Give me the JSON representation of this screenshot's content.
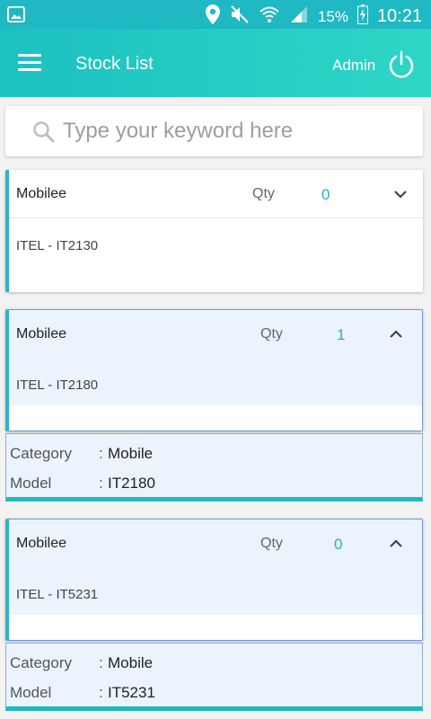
{
  "status_bar": {
    "battery": "15%",
    "time": "10:21",
    "icons": [
      "image-icon",
      "location-icon",
      "mute-icon",
      "wifi-icon",
      "signal-icon",
      "battery-charging-icon"
    ]
  },
  "app_bar": {
    "title": "Stock List",
    "user": "Admin"
  },
  "search": {
    "placeholder": "Type your keyword here"
  },
  "labels": {
    "qty": "Qty",
    "category": "Category",
    "model": "Model",
    "separator": ":"
  },
  "items": [
    {
      "brand": "Mobilee",
      "qty": "0",
      "name": "ITEL - IT2130",
      "expanded": false
    },
    {
      "brand": "Mobilee",
      "qty": "1",
      "name": "ITEL - IT2180",
      "expanded": true,
      "category": "Mobile",
      "model": "IT2180"
    },
    {
      "brand": "Mobilee",
      "qty": "0",
      "name": "ITEL - IT5231",
      "expanded": true,
      "category": "Mobile",
      "model": "IT5231"
    }
  ],
  "colors": {
    "primary": "#1fb8c3",
    "accent_text": "#1fb3c4",
    "expanded_bg": "#ebf3fd"
  }
}
